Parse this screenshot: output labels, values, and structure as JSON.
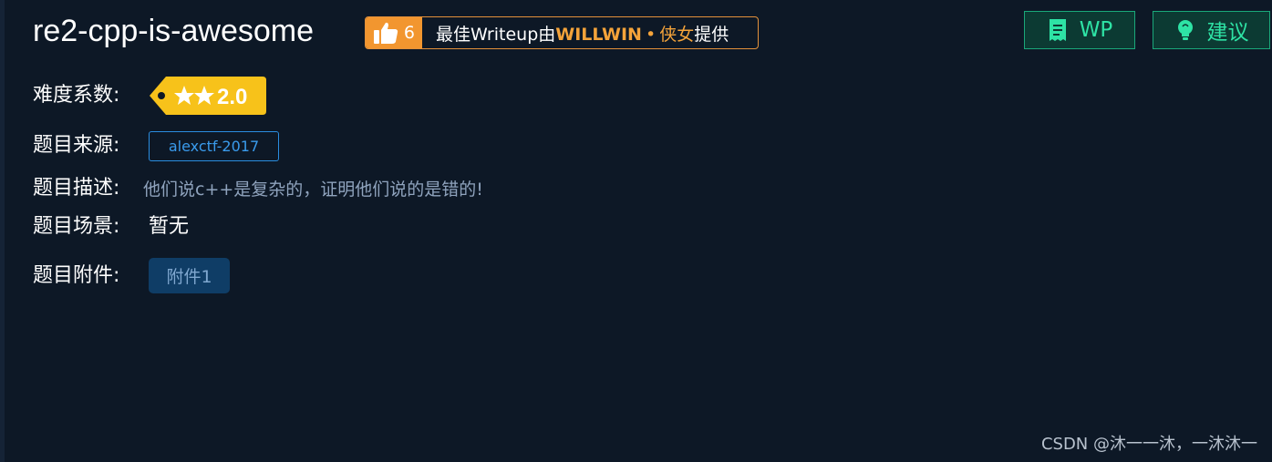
{
  "header": {
    "title": "re2-cpp-is-awesome",
    "writeup": {
      "like_count": "6",
      "prefix": "最佳Writeup由",
      "author": "WILLWIN",
      "dot": "•",
      "tag": "侠女",
      "suffix": "提供"
    },
    "buttons": {
      "wp_label": "WP",
      "advice_label": "建议"
    }
  },
  "details": {
    "difficulty_label": "难度系数:",
    "difficulty_value": "2.0",
    "difficulty_stars": 2,
    "source_label": "题目来源:",
    "source_value": "alexctf-2017",
    "description_label": "题目描述:",
    "description_value": "他们说c++是复杂的，证明他们说的是错的!",
    "scene_label": "题目场景:",
    "scene_value": "暂无",
    "attachment_label": "题目附件:",
    "attachment_button": "附件1"
  },
  "watermark": "CSDN @沐一一沐，一沐沐一",
  "colors": {
    "background": "#0d1826",
    "accent_orange": "#f2962f",
    "accent_green": "#2ee3a5",
    "tag_yellow": "#f7c21a",
    "link_blue": "#2a8de0"
  }
}
